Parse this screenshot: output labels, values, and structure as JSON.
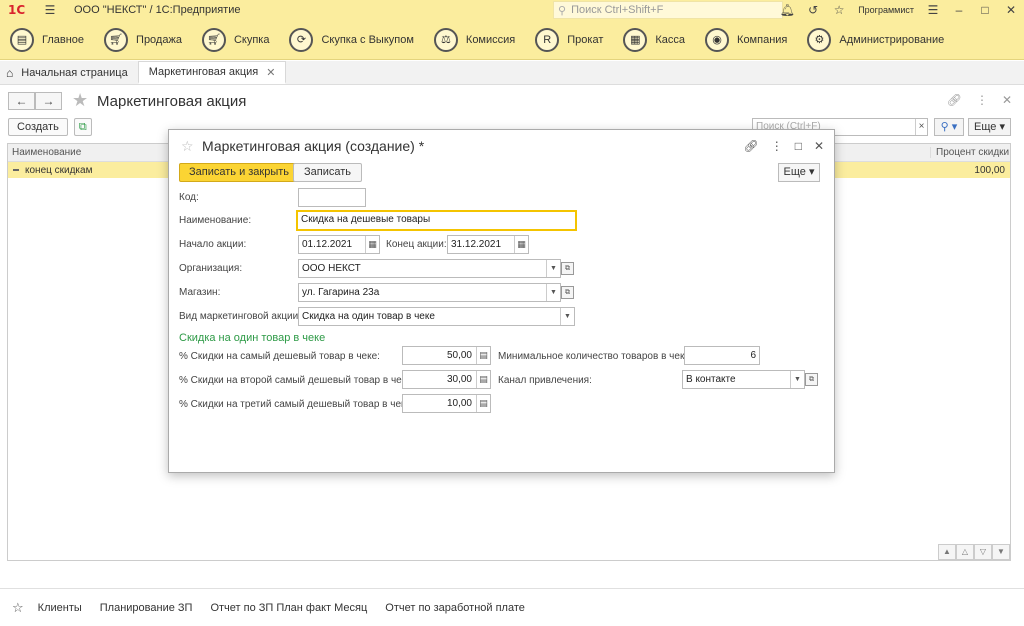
{
  "titlebar": {
    "logo": "1С",
    "title": "ООО \"НЕКСТ\" / 1С:Предприятие",
    "search_placeholder": "Поиск Ctrl+Shift+F",
    "user": "Программист"
  },
  "sections": [
    {
      "label": "Главное",
      "icon": "home-section-icon"
    },
    {
      "label": "Продажа",
      "icon": "cart-icon"
    },
    {
      "label": "Скупка",
      "icon": "cart-buy-icon"
    },
    {
      "label": "Скупка с Выкупом",
      "icon": "cycle-icon"
    },
    {
      "label": "Комиссия",
      "icon": "scales-icon"
    },
    {
      "label": "Прокат",
      "icon": "rent-icon"
    },
    {
      "label": "Касса",
      "icon": "cash-register-icon"
    },
    {
      "label": "Компания",
      "icon": "company-icon"
    },
    {
      "label": "Администрирование",
      "icon": "gears-icon"
    }
  ],
  "tabs": {
    "home": "Начальная страница",
    "active": "Маркетинговая акция"
  },
  "main": {
    "title": "Маркетинговая акция",
    "create": "Создать",
    "search_placeholder": "Поиск (Ctrl+F)",
    "more": "Еще",
    "columns": {
      "name": "Наименование",
      "pct": "Процент скидки"
    },
    "rows": [
      {
        "name": "конец скидкам",
        "pct": "100,00"
      }
    ]
  },
  "modal": {
    "title": "Маркетинговая акция (создание) *",
    "save_close": "Записать и закрыть",
    "save": "Записать",
    "more": "Еще",
    "code_label": "Код:",
    "code_value": "",
    "name_label": "Наименование:",
    "name_value": "Скидка на дешевые товары",
    "start_label": "Начало акции:",
    "start_value": "01.12.2021",
    "end_label": "Конец акции:",
    "end_value": "31.12.2021",
    "org_label": "Организация:",
    "org_value": "ООО НЕКСТ",
    "shop_label": "Магазин:",
    "shop_value": "ул. Гагарина 23а",
    "kind_label": "Вид маркетинговой акции:",
    "kind_value": "Скидка на один товар в чеке",
    "group_title": "Скидка на один товар в чеке",
    "d1_label": "% Скидки на самый дешевый товар в чеке:",
    "d1_value": "50,00",
    "d2_label": "% Скидки на второй самый дешевый товар в чеке:",
    "d2_value": "30,00",
    "d3_label": "% Скидки на третий самый дешевый товар в чеке:",
    "d3_value": "10,00",
    "minqty_label": "Минимальное количество товаров в чеке:",
    "minqty_value": "6",
    "channel_label": "Канал привлечения:",
    "channel_value": "В контакте"
  },
  "footer": [
    "Клиенты",
    "Планирование ЗП",
    "Отчет по ЗП План факт Месяц",
    "Отчет по заработной плате"
  ]
}
